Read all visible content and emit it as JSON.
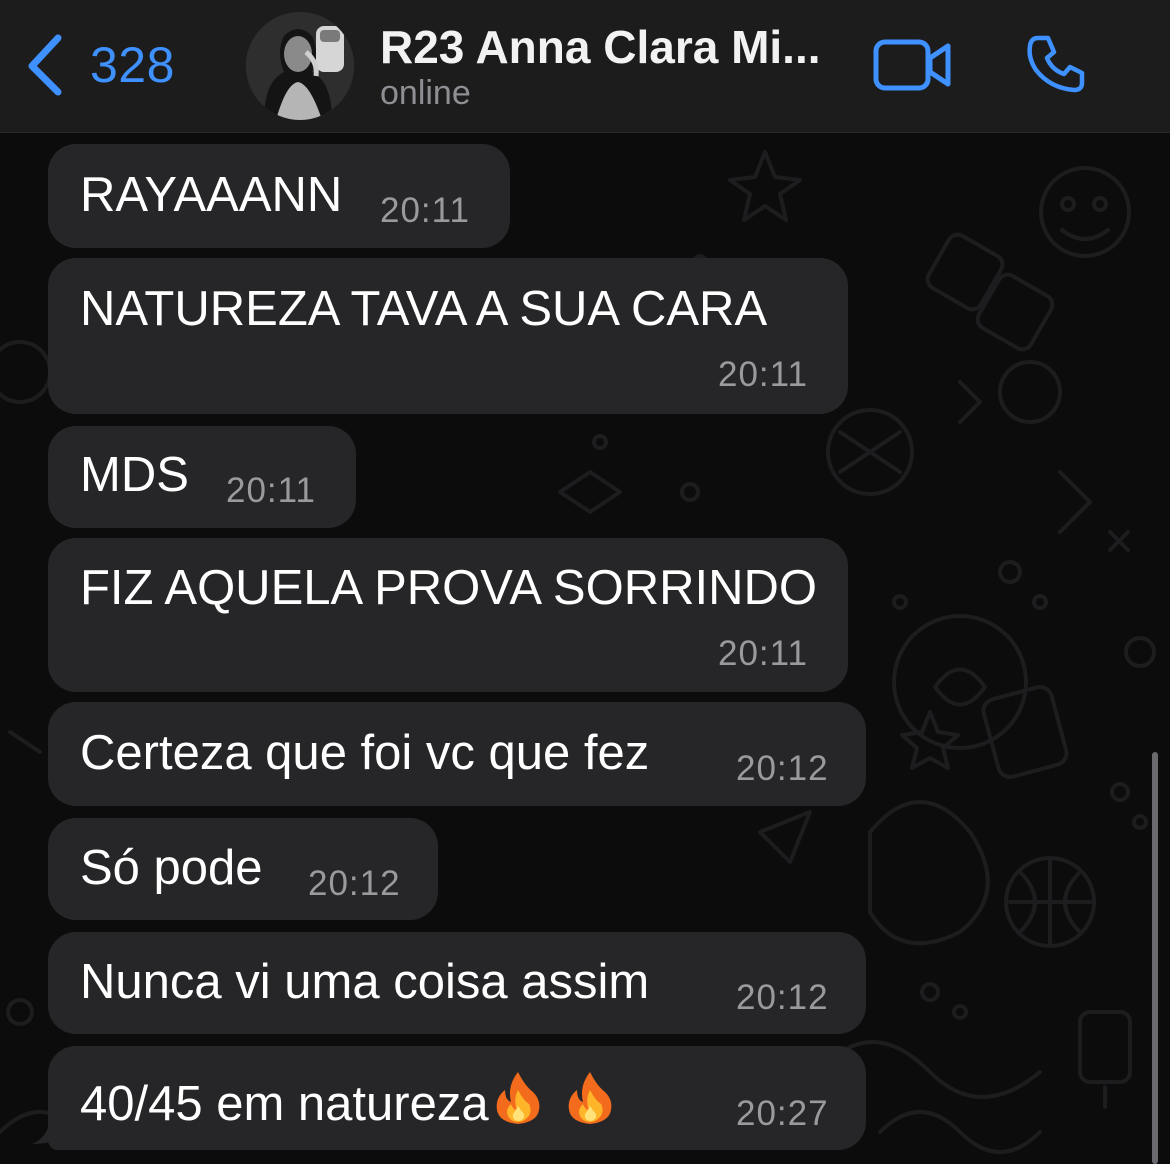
{
  "header": {
    "back_count": "328",
    "contact_name": "R23 Anna Clara Mi...",
    "status": "online",
    "icons": {
      "back": "chevron-left-icon",
      "video": "video-call-icon",
      "phone": "phone-call-icon"
    }
  },
  "messages": [
    {
      "text": "RAYAAANN",
      "time": "20:11"
    },
    {
      "text": "NATUREZA TAVA A SUA CARA",
      "time": "20:11"
    },
    {
      "text": "MDS",
      "time": "20:11"
    },
    {
      "text": "FIZ AQUELA PROVA SORRINDO",
      "time": "20:11"
    },
    {
      "text": "Certeza que foi vc que fez",
      "time": "20:12"
    },
    {
      "text": "Só pode",
      "time": "20:12"
    },
    {
      "text": "Nunca vi uma coisa assim",
      "time": "20:12"
    },
    {
      "text": "40/45 em natureza",
      "time": "20:27",
      "emoji": "fire-emoji fire-emoji"
    }
  ],
  "colors": {
    "accent": "#3e91ff",
    "bubble": "#262628",
    "header_bg": "#1c1c1d",
    "background": "#0c0c0c",
    "timestamp": "#9a9a9e"
  }
}
